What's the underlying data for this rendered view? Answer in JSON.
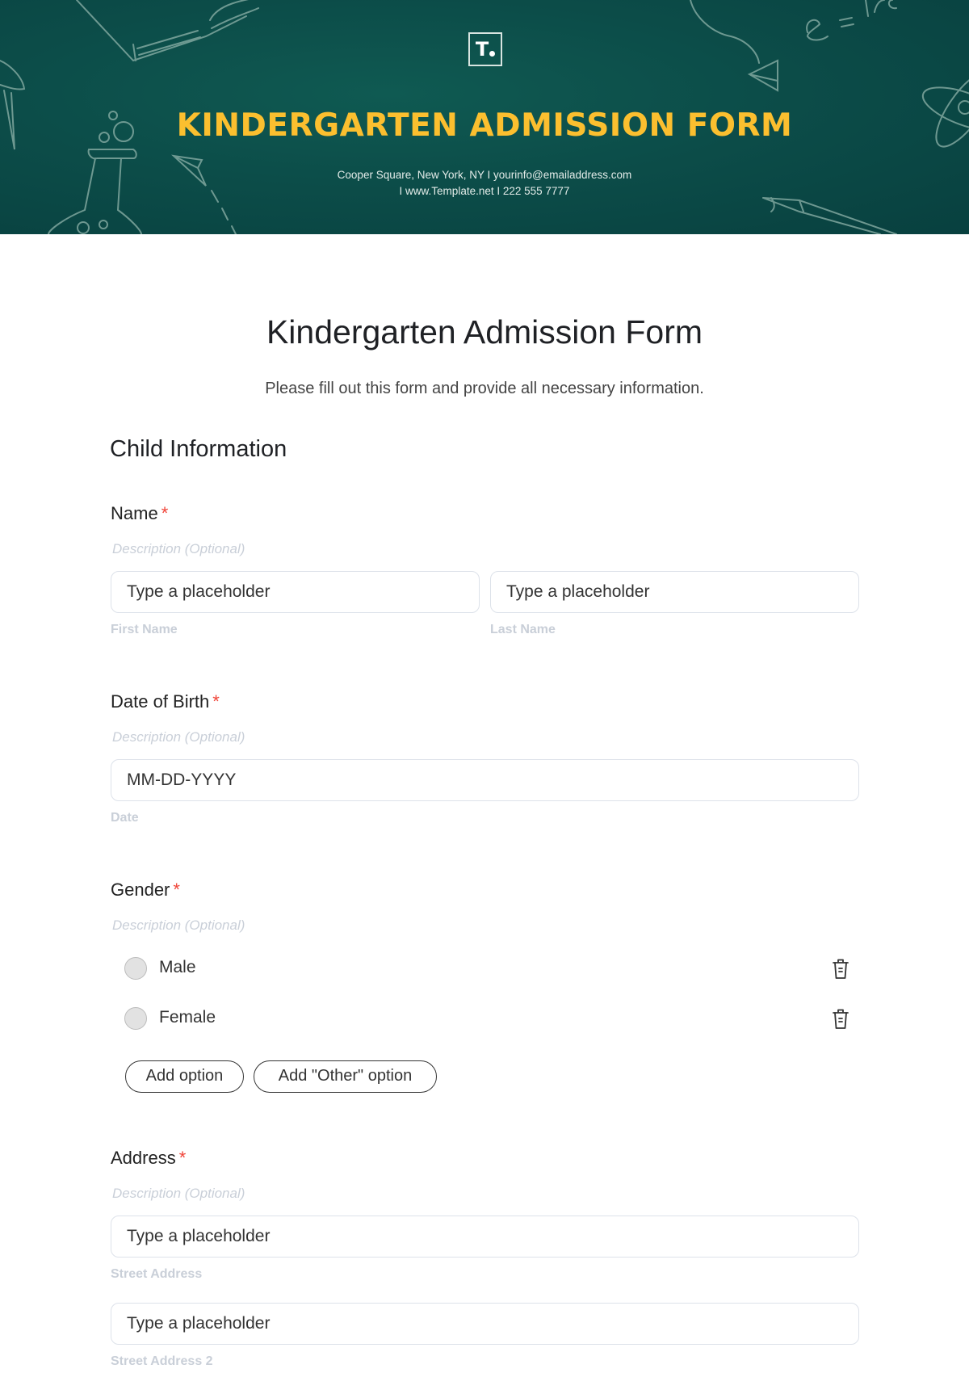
{
  "header": {
    "logo_letter": "T",
    "title": "KINDERGARTEN ADMISSION FORM",
    "contact_line1": "Cooper Square, New York, NY  I  yourinfo@emailaddress.com",
    "contact_line2": "I  www.Template.net  I  222 555 7777",
    "colors": {
      "background": "#0c4d49",
      "title": "#FBBF2F"
    }
  },
  "form": {
    "title": "Kindergarten Admission Form",
    "subtitle": "Please fill out this form and provide all necessary information.",
    "section_title": "Child Information",
    "required_marker": "*",
    "fields": {
      "name": {
        "label": "Name",
        "description": "Description (Optional)",
        "inputs": [
          {
            "placeholder": "Type a placeholder",
            "sublabel": "First Name"
          },
          {
            "placeholder": "Type a placeholder",
            "sublabel": "Last Name"
          }
        ]
      },
      "dob": {
        "label": "Date of Birth",
        "description": "Description (Optional)",
        "placeholder": "MM-DD-YYYY",
        "sublabel": "Date"
      },
      "gender": {
        "label": "Gender",
        "description": "Description (Optional)",
        "options": [
          {
            "label": "Male",
            "icon": "trash-icon"
          },
          {
            "label": "Female",
            "icon": "trash-icon"
          }
        ],
        "add_option_label": "Add option",
        "add_other_label": "Add \"Other\" option"
      },
      "address": {
        "label": "Address",
        "description": "Description (Optional)",
        "inputs": [
          {
            "placeholder": "Type a placeholder",
            "sublabel": "Street Address"
          },
          {
            "placeholder": "Type a placeholder",
            "sublabel": "Street Address 2"
          }
        ]
      }
    },
    "colors": {
      "required": "#f04438",
      "muted": "#c9cfd8",
      "border": "#dde2ea"
    }
  }
}
